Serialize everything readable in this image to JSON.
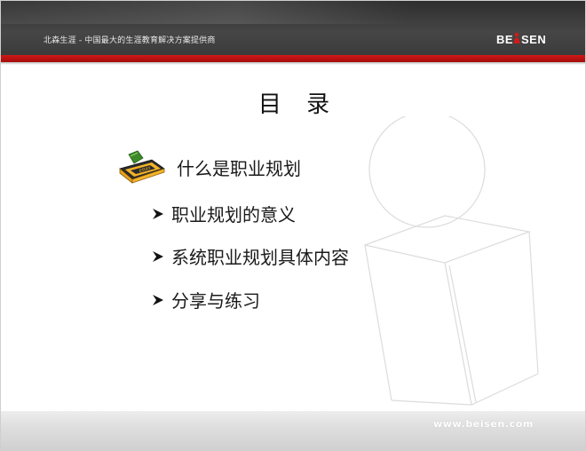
{
  "header": {
    "tagline": "北森生涯 - 中国最大的生涯教育解决方案提供商",
    "logo_text": "BEISEN"
  },
  "title": "目 录",
  "agenda": {
    "current": {
      "label": "什么是职业规划",
      "icon": "crayon-icon"
    },
    "items": [
      {
        "label": "职业规划的意义",
        "icon": "arrow-bullet-icon"
      },
      {
        "label": "系统职业规划具体内容",
        "icon": "arrow-bullet-icon"
      },
      {
        "label": "分享与练习",
        "icon": "arrow-bullet-icon"
      }
    ]
  },
  "footer": {
    "url": "www.beisen.com"
  },
  "colors": {
    "header_bg": "#3a3a3a",
    "accent_red": "#c41414",
    "footer_bg": "#dcdcdc",
    "text": "#1a1a1a"
  }
}
